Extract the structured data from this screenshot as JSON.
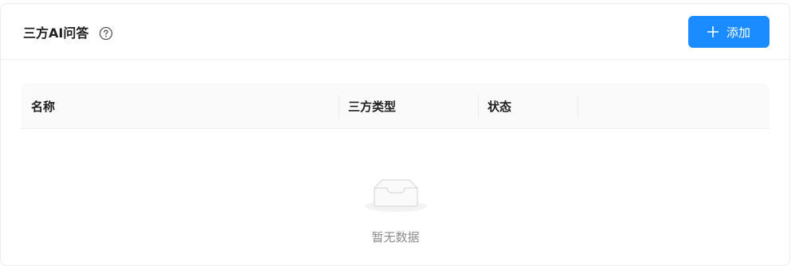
{
  "header": {
    "title": "三方AI问答",
    "add_label": "添加"
  },
  "table": {
    "columns": [
      "名称",
      "三方类型",
      "状态",
      ""
    ],
    "rows": []
  },
  "empty": {
    "text": "暂无数据"
  },
  "colors": {
    "primary": "#1a8cff",
    "header_bg": "#fafafa",
    "muted_text": "#8c8c8c"
  },
  "icons": {
    "help": "question-circle-icon",
    "add": "plus-icon",
    "empty": "empty-inbox-icon"
  }
}
